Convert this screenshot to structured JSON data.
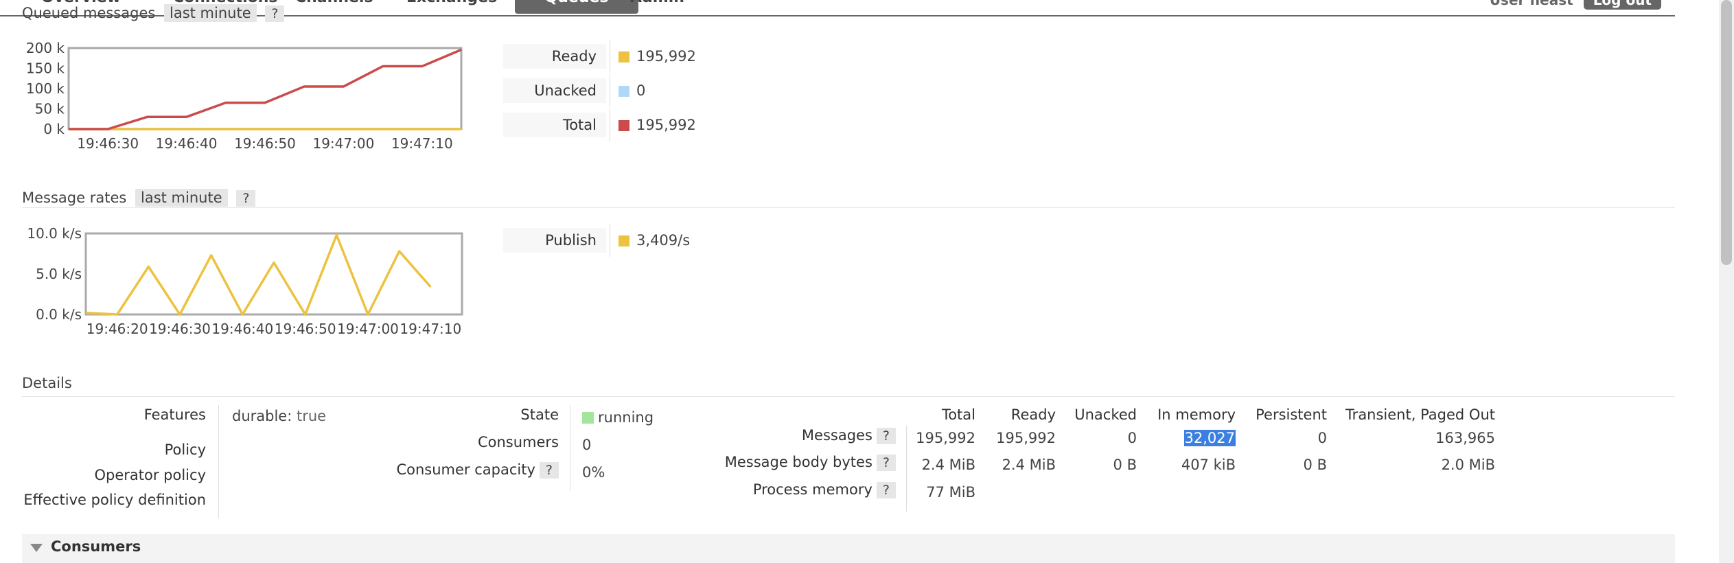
{
  "nav": {
    "tabs": [
      "Overview",
      "Connections",
      "Channels",
      "Exchanges",
      "Queues",
      "Admin"
    ],
    "active_tab": "Queues",
    "user_label": "User",
    "user_name": "fleast",
    "logout_label": "Log out"
  },
  "queued": {
    "title": "Queued messages",
    "range": "last minute",
    "help": "?",
    "legend": [
      {
        "label": "Ready",
        "value": "195,992",
        "color": "#edc240"
      },
      {
        "label": "Unacked",
        "value": "0",
        "color": "#afd8f8"
      },
      {
        "label": "Total",
        "value": "195,992",
        "color": "#cb4b4b"
      }
    ]
  },
  "rates": {
    "title": "Message rates",
    "range": "last minute",
    "help": "?",
    "legend": [
      {
        "label": "Publish",
        "value": "3,409/s",
        "color": "#edc240"
      }
    ]
  },
  "chart_data": [
    {
      "type": "line",
      "title": "Queued messages",
      "x": [
        "19:46:25",
        "19:46:30",
        "19:46:35",
        "19:46:40",
        "19:46:45",
        "19:46:50",
        "19:46:55",
        "19:47:00",
        "19:47:05",
        "19:47:10",
        "19:47:15"
      ],
      "xticks": [
        "19:46:30",
        "19:46:40",
        "19:46:50",
        "19:47:00",
        "19:47:10"
      ],
      "yticks": [
        "200 k",
        "150 k",
        "100 k",
        "50 k",
        "0 k"
      ],
      "ylim": [
        0,
        200000
      ],
      "series": [
        {
          "name": "Total",
          "color": "#cb4b4b",
          "values": [
            0,
            0,
            30000,
            30000,
            65000,
            65000,
            105000,
            105000,
            155000,
            155000,
            195992
          ]
        },
        {
          "name": "Ready",
          "color": "#edc240",
          "values": [
            0,
            0,
            0,
            0,
            0,
            0,
            0,
            0,
            0,
            0,
            0
          ]
        },
        {
          "name": "Unacked",
          "color": "#afd8f8",
          "values": [
            0,
            0,
            0,
            0,
            0,
            0,
            0,
            0,
            0,
            0,
            0
          ]
        }
      ]
    },
    {
      "type": "line",
      "title": "Message rates",
      "x": [
        "19:46:15",
        "19:46:20",
        "19:46:25",
        "19:46:30",
        "19:46:35",
        "19:46:40",
        "19:46:45",
        "19:46:50",
        "19:46:55",
        "19:47:00",
        "19:47:05",
        "19:47:10",
        "19:47:15"
      ],
      "xticks": [
        "19:46:20",
        "19:46:30",
        "19:46:40",
        "19:46:50",
        "19:47:00",
        "19:47:10"
      ],
      "yticks": [
        "10.0 k/s",
        "5.0 k/s",
        "0.0 k/s"
      ],
      "ylim": [
        0,
        10000
      ],
      "series": [
        {
          "name": "Publish",
          "color": "#edc240",
          "values": [
            200,
            0,
            5900,
            0,
            7300,
            0,
            6400,
            0,
            9800,
            0,
            7800,
            3400
          ]
        }
      ]
    }
  ],
  "details": {
    "title": "Details",
    "features_label": "Features",
    "features_key": "durable:",
    "features_val": "true",
    "policy_label": "Policy",
    "operator_policy_label": "Operator policy",
    "effective_policy_label": "Effective policy definition",
    "state_label": "State",
    "state_value": "running",
    "state_color": "#a3e59c",
    "consumers_label": "Consumers",
    "consumers_value": "0",
    "capacity_label": "Consumer capacity",
    "capacity_value": "0%",
    "help": "?",
    "columns": [
      "Total",
      "Ready",
      "Unacked",
      "In memory",
      "Persistent",
      "Transient, Paged Out"
    ],
    "rows": [
      {
        "label": "Messages",
        "values": [
          "195,992",
          "195,992",
          "0",
          "32,027",
          "0",
          "163,965"
        ]
      },
      {
        "label": "Message body bytes",
        "values": [
          "2.4 MiB",
          "2.4 MiB",
          "0 B",
          "407 kiB",
          "0 B",
          "2.0 MiB"
        ]
      },
      {
        "label": "Process memory",
        "values": [
          "77 MiB"
        ]
      }
    ]
  },
  "consumers_section": {
    "label": "Consumers"
  }
}
